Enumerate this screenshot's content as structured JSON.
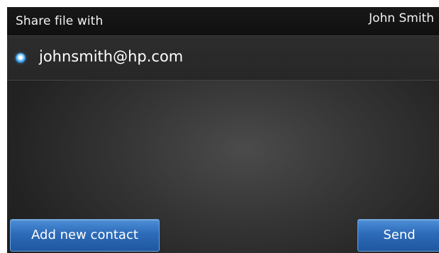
{
  "header": {
    "title": "Share file with",
    "user_name": "John Smith"
  },
  "contacts": [
    {
      "label": "johnsmith@hp.com",
      "selected": true
    }
  ],
  "buttons": {
    "add_contact_label": "Add new contact",
    "send_label": "Send"
  },
  "colors": {
    "accent_blue": "#2d6bb9",
    "radio_selected": "#2f98e8"
  }
}
